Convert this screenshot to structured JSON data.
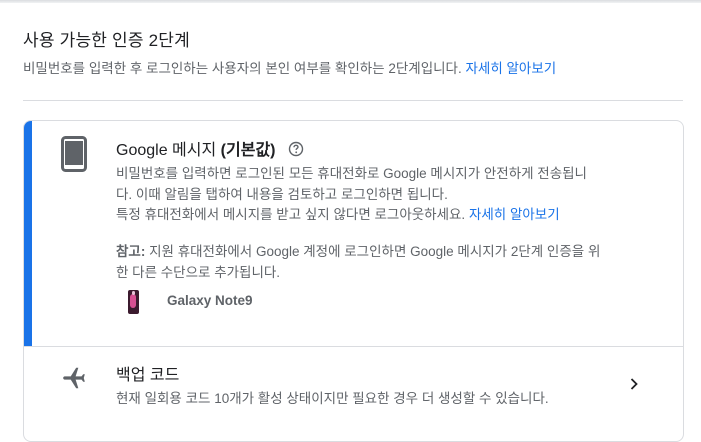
{
  "section": {
    "title": "사용 가능한 인증 2단계",
    "description": "비밀번호를 입력한 후 로그인하는 사용자의 본인 여부를 확인하는 2단계입니다.",
    "learn_more": "자세히 알아보기"
  },
  "google_prompt": {
    "title_brand": "Google",
    "title_rest": "메시지",
    "title_default": "(기본값)",
    "icon": "smartphone-icon",
    "body_line1": "비밀번호를 입력하면 로그인된 모든 휴대전화로 Google 메시지가 안전하게 전송됩니",
    "body_line2": "다. 이때 알림을 탭하여 내용을 검토하고 로그인하면 됩니다.",
    "body_line3": "특정 휴대전화에서 메시지를 받고 싶지 않다면 로그아웃하세요.",
    "learn_more": "자세히 알아보기",
    "note_label": "참고:",
    "note_line1": "지원 휴대전화에서 Google 계정에 로그인하면 Google 메시지가 2단계 인증을 위",
    "note_line2": "한 다른 수단으로 추가됩니다.",
    "device_name": "Galaxy Note9"
  },
  "backup_codes": {
    "title": "백업 코드",
    "description": "현재 일회용 코드 10개가 활성 상태이지만 필요한 경우 더 생성할 수 있습니다.",
    "icon": "airplane-icon"
  },
  "colors": {
    "accent": "#1a73e8",
    "text_primary": "#202124",
    "text_secondary": "#5f6368",
    "border": "#dadce0"
  }
}
